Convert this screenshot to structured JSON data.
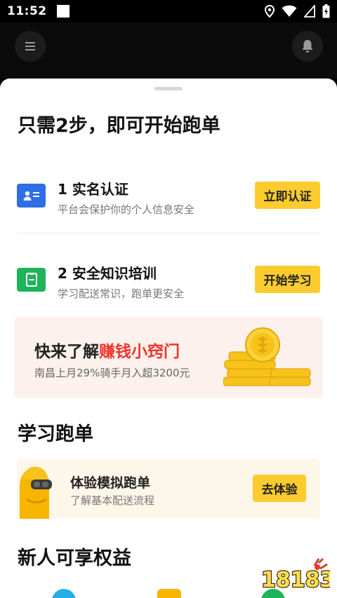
{
  "status_bar": {
    "time": "11:52"
  },
  "sheet": {
    "heading": "只需2步，即可开始跑单",
    "steps": [
      {
        "title": "1 实名认证",
        "desc": "平台会保护你的个人信息安全",
        "button": "立即认证",
        "icon": "id-card-icon",
        "icon_color": "#2f6ee6"
      },
      {
        "title": "2 安全知识培训",
        "desc": "学习配送常识，跑单更安全",
        "button": "开始学习",
        "icon": "document-icon",
        "icon_color": "#1fb35a"
      }
    ],
    "banner": {
      "title_prefix": "快来了解",
      "title_highlight": "赚钱小窍门",
      "desc": "南昌上月29%骑手月入超3200元",
      "highlight_color": "#f0342c",
      "icon": "gold-coins-icon"
    },
    "learn_section": {
      "heading": "学习跑单",
      "card": {
        "title": "体验模拟跑单",
        "desc": "了解基本配送流程",
        "button": "去体验",
        "icon": "rider-mascot-icon"
      }
    },
    "perks_section": {
      "heading": "新人可享权益"
    }
  },
  "watermark": {
    "text": "18183"
  },
  "colors": {
    "accent_yellow": "#fccc2e",
    "banner_bg": "#fcf1ec",
    "sim_card_bg": "#fdf7e9"
  }
}
